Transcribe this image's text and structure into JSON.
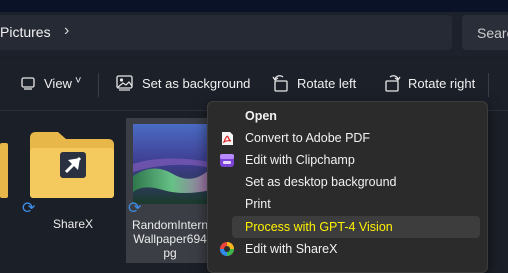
{
  "address_bar": {
    "breadcrumb": "Pictures",
    "chevron": "›"
  },
  "search": {
    "placeholder": "Search"
  },
  "toolbar": {
    "view_label": "View",
    "view_chevron": "˅",
    "set_background_label": "Set as background",
    "rotate_left_label": "Rotate left",
    "rotate_right_label": "Rotate right"
  },
  "files": [
    {
      "name": "ShareX",
      "icon": "folder-icon",
      "sync_icon": "sync-icon"
    },
    {
      "name_lines": [
        "RandomIntern",
        "Wallpaper694",
        "pg"
      ],
      "icon": "image-thumbnail",
      "sync_icon": "sync-icon"
    }
  ],
  "context_menu": {
    "items": [
      {
        "label": "Open",
        "icon": null,
        "bold": true
      },
      {
        "label": "Convert to Adobe PDF",
        "icon": "adobe-pdf-icon"
      },
      {
        "label": "Edit with Clipchamp",
        "icon": "clipchamp-icon"
      },
      {
        "label": "Set as desktop background",
        "icon": null
      },
      {
        "label": "Print",
        "icon": null
      },
      {
        "label": "Process with GPT-4 Vision",
        "icon": null,
        "highlighted": true
      },
      {
        "label": "Edit with ShareX",
        "icon": "sharex-icon"
      }
    ]
  },
  "colors": {
    "accent_sync": "#3d8ee8",
    "highlight_text": "#fff200",
    "folder": "#e8b74a"
  }
}
